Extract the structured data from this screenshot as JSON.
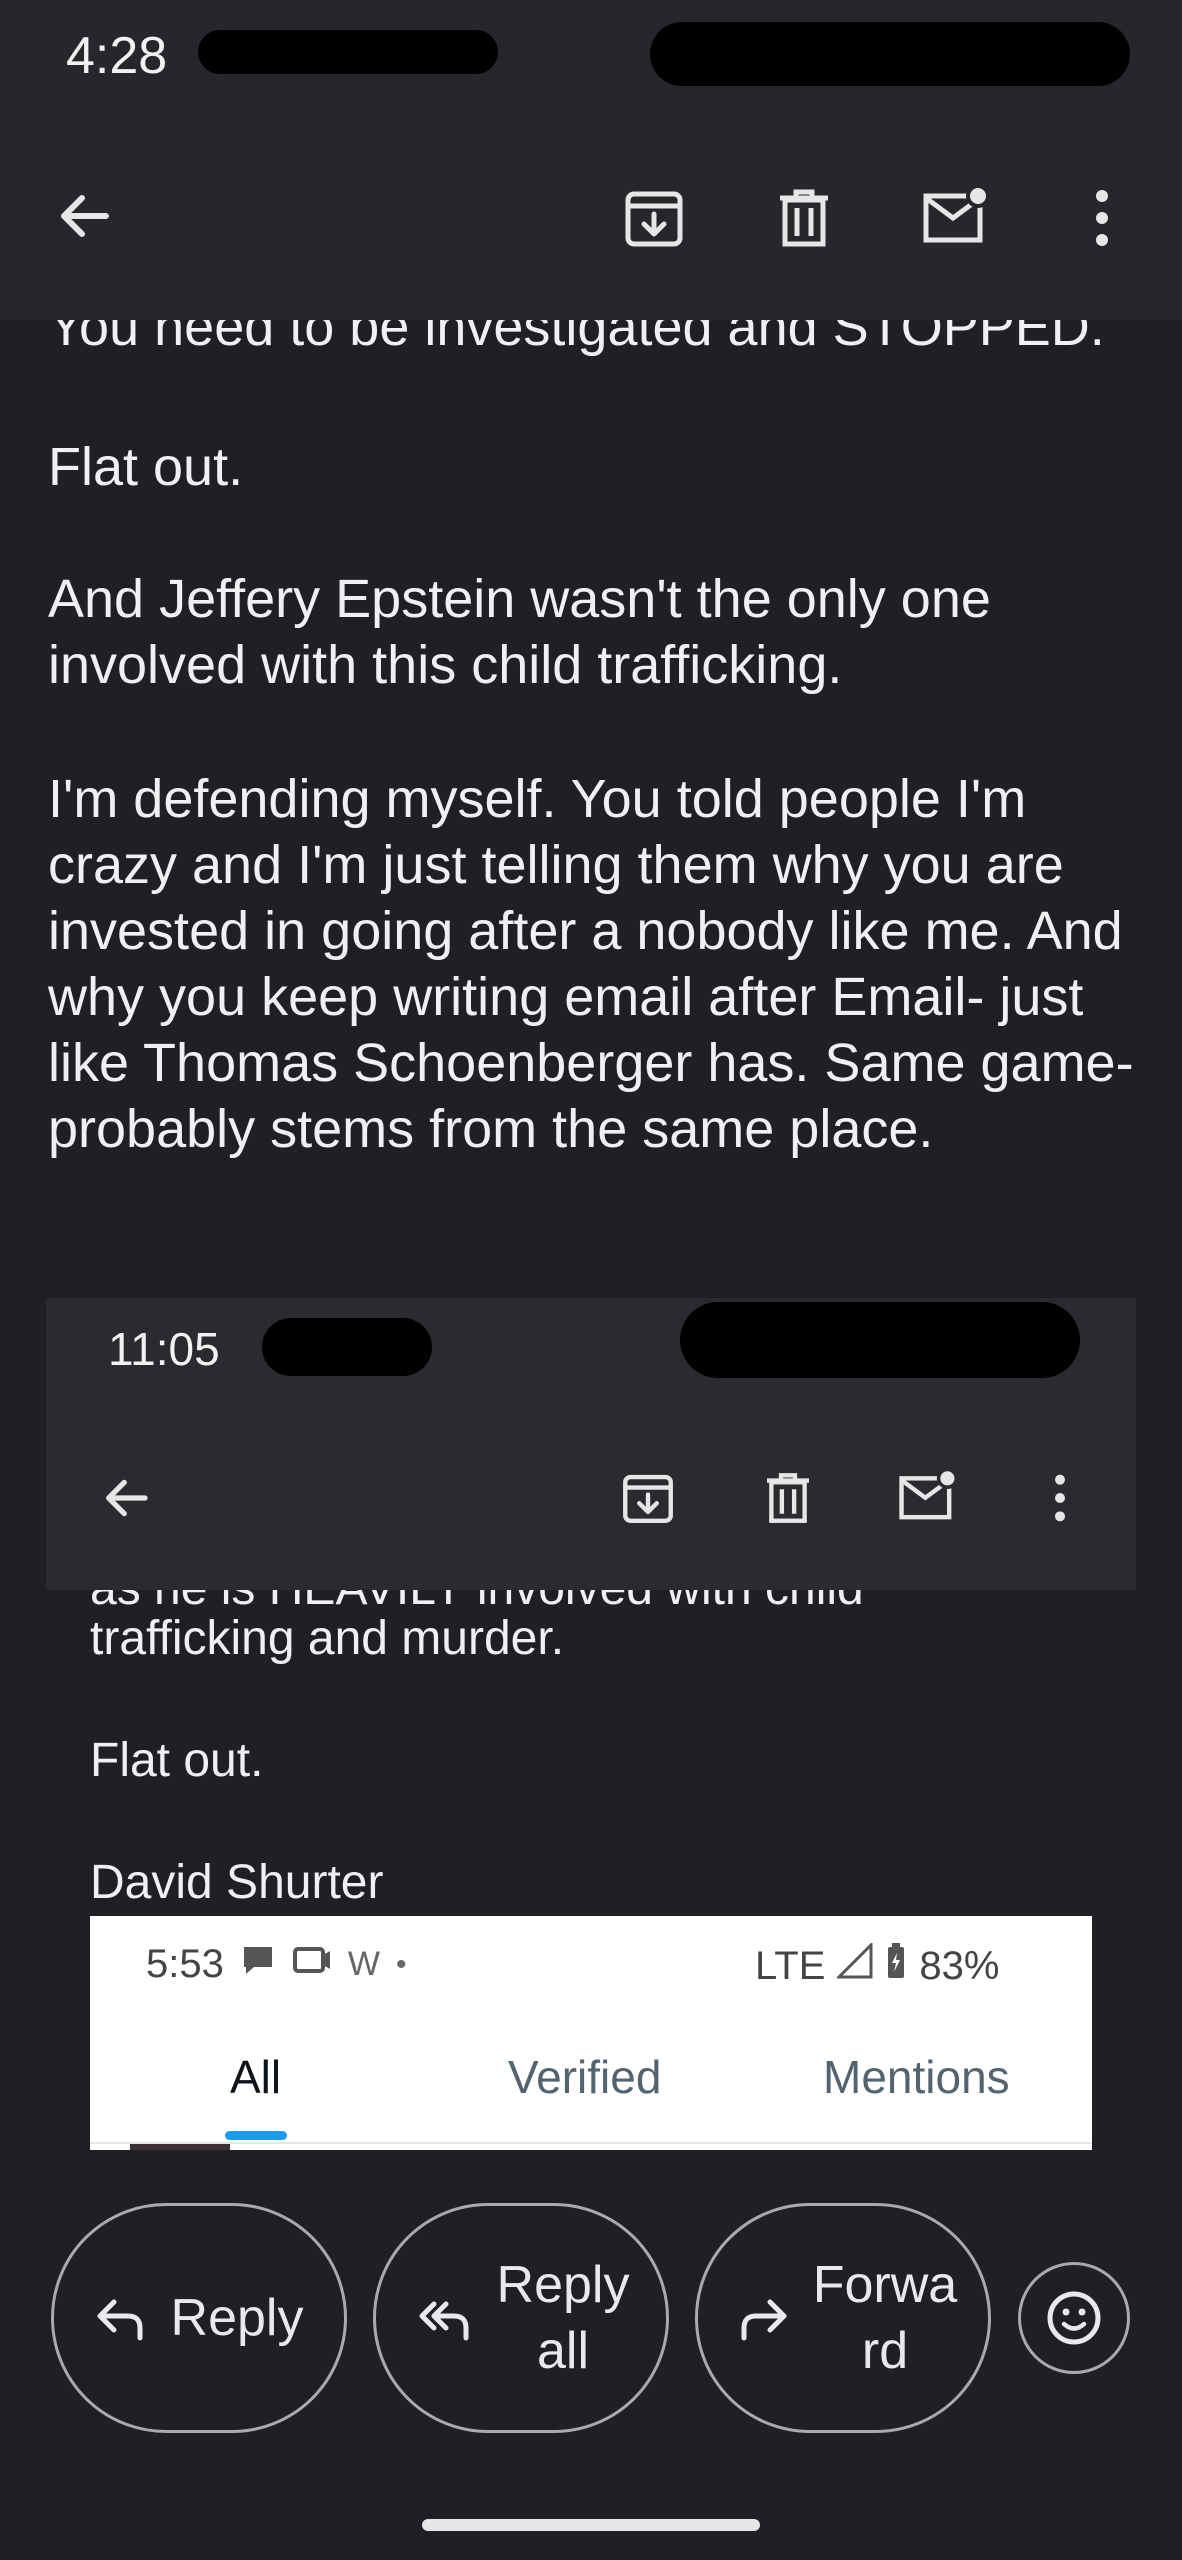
{
  "status_bar": {
    "time": "4:28"
  },
  "toolbar": {
    "icons": [
      "back-arrow-icon",
      "archive-icon",
      "trash-icon",
      "mark-unread-icon",
      "more-vert-icon"
    ]
  },
  "message": {
    "partial_top_line": "You need to be investigated and STOPPED.",
    "p1": "Flat out.",
    "p2": "And Jeffery Epstein wasn't the only one involved with this child trafficking.",
    "p3": "I'm defending myself. You told people I'm crazy and I'm just telling them why you are invested in going after a nobody like me. And why you keep writing email after Email- just like Thomas Schoenberger has. Same game- probably stems from the same place."
  },
  "embedded_screenshot_1": {
    "time": "11:05",
    "partial_line": "as he is HEAVILY involved with child",
    "line1": "trafficking and murder.",
    "line2": "Flat out.",
    "signature": "David Shurter"
  },
  "embedded_screenshot_2": {
    "time": "5:53",
    "status_icons_text": "W",
    "network": "LTE",
    "battery": "83%",
    "tabs": [
      "All",
      "Verified",
      "Mentions"
    ],
    "active_tab": "All",
    "accent_color": "#1d9bf0"
  },
  "actions": {
    "reply": "Reply",
    "reply_all": "Reply all",
    "forward": "Forward"
  },
  "colors": {
    "background": "#1f1f24",
    "toolbar": "#26262b",
    "button_border": "#a9a9b0"
  }
}
